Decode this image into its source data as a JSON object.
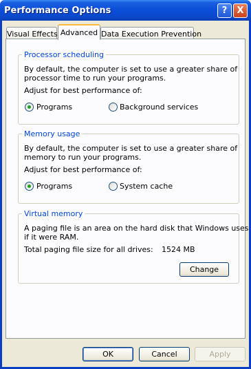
{
  "window": {
    "title": "Performance Options"
  },
  "titlebar": {
    "help_glyph": "?",
    "close_glyph": "X"
  },
  "tabs": [
    {
      "label": "Visual Effects"
    },
    {
      "label": "Advanced"
    },
    {
      "label": "Data Execution Prevention"
    }
  ],
  "processor": {
    "title": "Processor scheduling",
    "desc1": "By default, the computer is set to use a greater share of",
    "desc2": "processor time to run your programs.",
    "adjust": "Adjust for best performance of:",
    "opt1": "Programs",
    "opt2": "Background services"
  },
  "memory": {
    "title": "Memory usage",
    "desc1": "By default, the computer is set to use a greater share of",
    "desc2": "memory to run your programs.",
    "adjust": "Adjust for best performance of:",
    "opt1": "Programs",
    "opt2": "System cache"
  },
  "virtual": {
    "title": "Virtual memory",
    "desc1": "A paging file is an area on the hard disk that Windows uses as",
    "desc2": "if it were RAM.",
    "size_label": "Total paging file size for all drives:",
    "size_value": "1524 MB",
    "change_label": "Change"
  },
  "footer": {
    "ok": "OK",
    "cancel": "Cancel",
    "apply": "Apply"
  },
  "colors": {
    "titlebar": "#0b4fd8",
    "group_title": "#0046d5",
    "highlight": "#d4148c",
    "radio_dot": "#21a121"
  }
}
